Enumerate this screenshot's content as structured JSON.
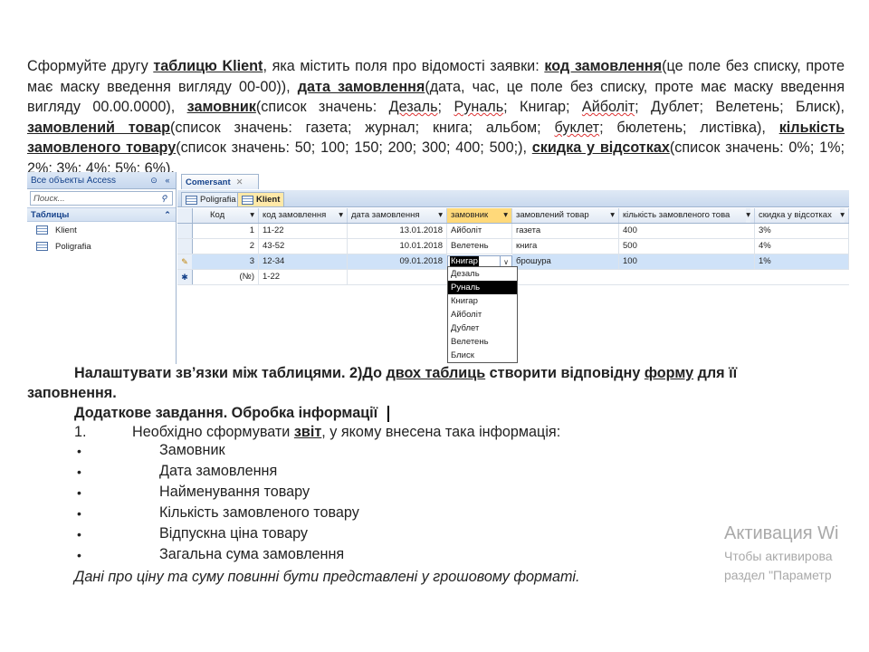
{
  "intro": {
    "p1": "Сформуйте другу ",
    "b1": "таблицю Klient",
    "p2": ", яка містить поля про відомості   заявки: ",
    "b2": "код замовлення",
    "p3": "(це поле без списку, проте має маску введення вигляду 00-00)), ",
    "b3": "дата замовлення",
    "p4": "(дата, час, це поле без списку, проте має маску введення вигляду 00.00.0000), ",
    "b4": "замовник",
    "p5a": "(список значень: ",
    "w1": "Дезаль",
    "p5b": "; ",
    "w2": "Руналь",
    "p5c": "; Книгар; ",
    "w3": "Айболіт",
    "p5d": "; Дублет; Велетень; Блиск), ",
    "b5": "замовлений товар",
    "p6": "(список значень: газета; журнал; книга; альбом; ",
    "w4": "буклет",
    "p6b": "; бюлетень; листівка), ",
    "b6": "кількість замовленого товару",
    "p7": "(список значень: 50; 100; 150; 200; 300; 400; 500;), ",
    "b7": "скидка у відсотках",
    "p8": "(список значень: 0%; 1%; 2%; 3%; 4%; 5%; 6%)."
  },
  "access": {
    "nav_title": "Все объекты Access",
    "search_placeholder": "Поиск...",
    "group_label": "Таблицы",
    "items": [
      "Klient",
      "Poligrafia"
    ],
    "doc_tab": "Comersant",
    "subtabs": [
      "Poligrafia",
      "Klient"
    ],
    "columns": [
      "Код",
      "код замовлення",
      "дата замовлення",
      "замовник",
      "замовлений товар",
      "кількість замовленого това",
      "скидка у відсотках"
    ],
    "rows": [
      {
        "code": "1",
        "order": "11-22",
        "date": "13.01.2018",
        "customer": "Айболіт",
        "product": "газета",
        "qty": "400",
        "disc": "3%",
        "marker": ""
      },
      {
        "code": "2",
        "order": "43-52",
        "date": "10.01.2018",
        "customer": "Велетень",
        "product": "книга",
        "qty": "500",
        "disc": "4%",
        "marker": ""
      },
      {
        "code": "3",
        "order": "12-34",
        "date": "09.01.2018",
        "customer": "Книгар",
        "product": "брошура",
        "qty": "100",
        "disc": "1%",
        "marker": "✎"
      },
      {
        "code": "(№)",
        "order": "1-22",
        "date": "",
        "customer": "",
        "product": "",
        "qty": "",
        "disc": "",
        "marker": "✱"
      }
    ],
    "dropdown": [
      "Дезаль",
      "Руналь",
      "Книгар",
      "Айболіт",
      "Дублет",
      "Велетень",
      "Блиск"
    ],
    "dropdown_highlight": "Руналь"
  },
  "task2": {
    "t1": "Налаштувати зв’язки між таблицями. 2)До ",
    "t2": "двох таблиць",
    "t3": " створити відповідну ",
    "t4": "форму",
    "t5": " для її",
    "t6": "заповнення."
  },
  "extra": {
    "title": "Додаткове завдання.   Обробка інформації",
    "num": "1.",
    "item1a": "Необхідно сформувати ",
    "item1b": "звіт",
    "item1c": ", у якому внесена така інформація:",
    "bullets": [
      "Замовник",
      "Дата замовлення",
      "Найменування товару",
      "Кількість замовленого товару",
      "Відпускна ціна товару",
      "Загальна сума замовлення"
    ],
    "bullet_symbol": "•",
    "note": "Дані про ціну та суму повинні бути представлені  у грошовому форматі."
  },
  "watermark": {
    "line1": "Активация Wi",
    "line2": "Чтобы активирова",
    "line3": "раздел \"Параметр"
  }
}
